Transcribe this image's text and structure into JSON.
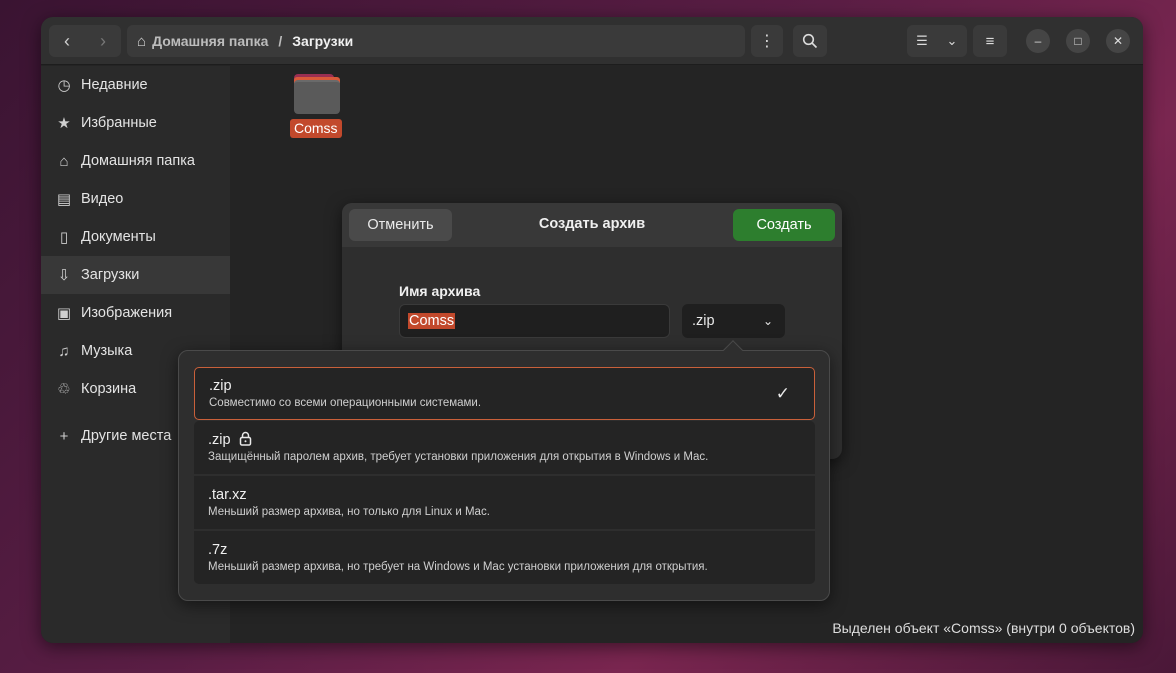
{
  "path": {
    "home": "Домашняя папка",
    "separator": "/",
    "current": "Загрузки"
  },
  "sidebar": {
    "items": [
      {
        "label": "Недавние",
        "icon": "clock-icon"
      },
      {
        "label": "Избранные",
        "icon": "star-icon"
      },
      {
        "label": "Домашняя папка",
        "icon": "home-icon"
      },
      {
        "label": "Видео",
        "icon": "film-icon"
      },
      {
        "label": "Документы",
        "icon": "document-icon"
      },
      {
        "label": "Загрузки",
        "icon": "download-icon",
        "active": true
      },
      {
        "label": "Изображения",
        "icon": "image-icon"
      },
      {
        "label": "Музыка",
        "icon": "music-icon"
      },
      {
        "label": "Корзина",
        "icon": "trash-icon"
      }
    ],
    "other_locations": "Другие места"
  },
  "files": [
    {
      "name": "Comss",
      "type": "folder",
      "selected": true
    }
  ],
  "status": "Выделен объект «Comss»  (внутри 0 объектов)",
  "dialog": {
    "cancel": "Отменить",
    "title": "Создать архив",
    "create": "Создать",
    "name_label": "Имя архива",
    "name_value": "Comss",
    "format": ".zip"
  },
  "formats": [
    {
      "name": ".zip",
      "desc": "Совместимо со всеми операционными системами.",
      "selected": true
    },
    {
      "name": ".zip",
      "desc": "Защищённый паролем архив, требует установки приложения для открытия в Windows и Mac.",
      "locked": true
    },
    {
      "name": ".tar.xz",
      "desc": "Меньший размер архива, но только для Linux и Mac."
    },
    {
      "name": ".7z",
      "desc": "Меньший размер архива, но требует на Windows и Mac установки приложения для открытия."
    }
  ],
  "colors": {
    "accent": "#c2492c",
    "create_button": "#2d7e2e",
    "selection_border": "#c9603a"
  }
}
